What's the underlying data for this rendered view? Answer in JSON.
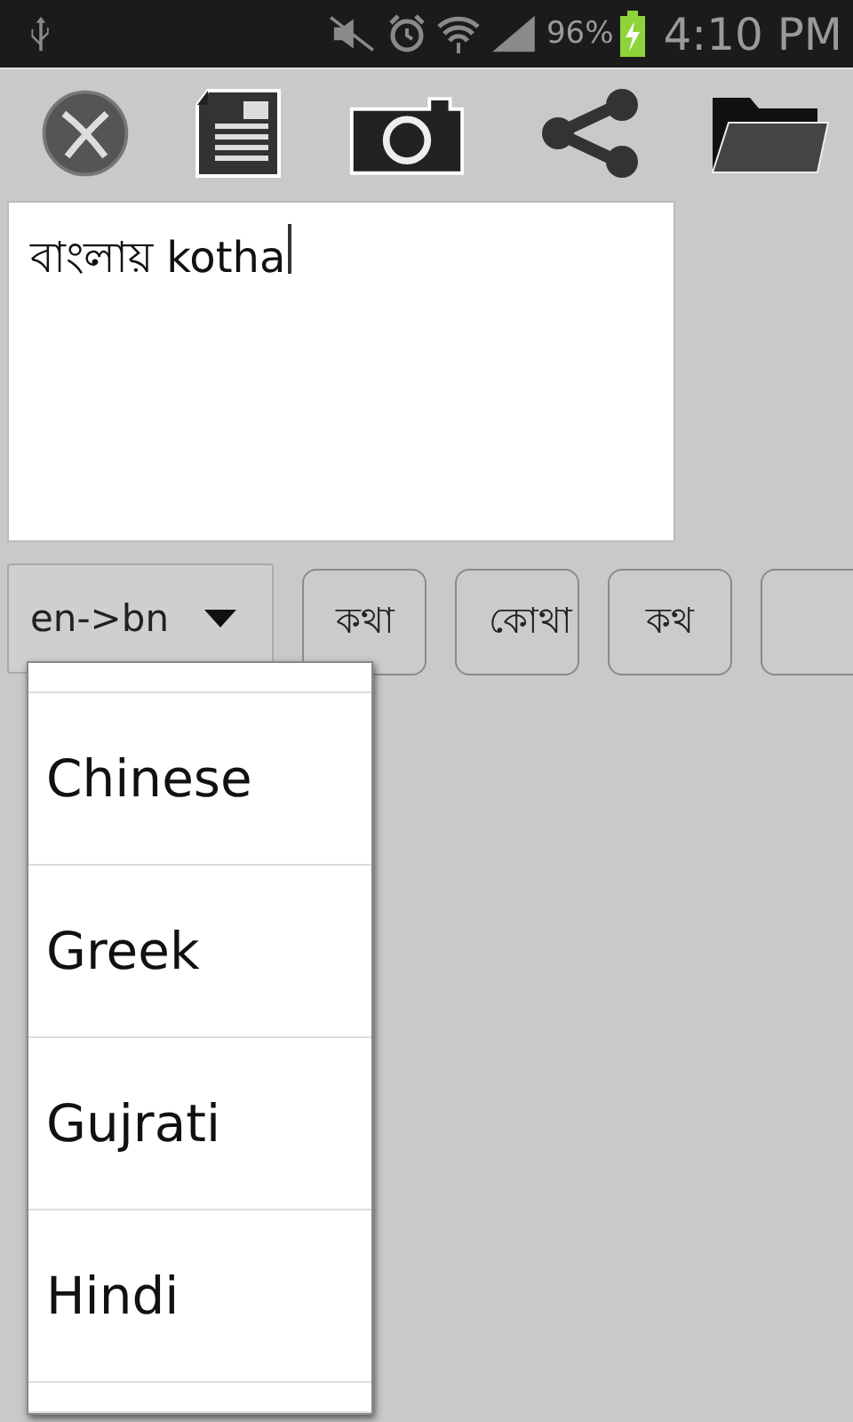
{
  "status_bar": {
    "battery": "96%",
    "time": "4:10 PM"
  },
  "toolbar": {
    "items": [
      {
        "kind": "close"
      },
      {
        "kind": "document"
      },
      {
        "kind": "camera"
      },
      {
        "kind": "share"
      },
      {
        "kind": "folder"
      }
    ]
  },
  "editor": {
    "value": "বাংলায় kotha"
  },
  "language_spinner": {
    "value": "en->bn",
    "expanded": true
  },
  "suggestions": [
    {
      "kind": "word",
      "label": "কথা"
    },
    {
      "kind": "word",
      "label": "কোথা"
    },
    {
      "kind": "word",
      "label": "কথ"
    },
    {
      "kind": "cut"
    }
  ],
  "dropdown": {
    "items": [
      {
        "kind": "cut"
      },
      {
        "kind": "option",
        "label": "Chinese"
      },
      {
        "kind": "option",
        "label": "Greek"
      },
      {
        "kind": "option",
        "label": "Gujrati"
      },
      {
        "kind": "option",
        "label": "Hindi"
      },
      {
        "kind": "cut"
      }
    ]
  }
}
